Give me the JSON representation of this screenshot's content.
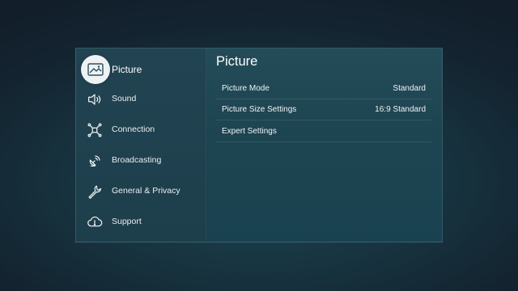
{
  "sidebar": {
    "items": [
      {
        "label": "Picture",
        "icon": "picture-icon",
        "selected": true
      },
      {
        "label": "Sound",
        "icon": "speaker-icon",
        "selected": false
      },
      {
        "label": "Connection",
        "icon": "connection-icon",
        "selected": false
      },
      {
        "label": "Broadcasting",
        "icon": "broadcast-icon",
        "selected": false
      },
      {
        "label": "General & Privacy",
        "icon": "wrench-icon",
        "selected": false
      },
      {
        "label": "Support",
        "icon": "support-cloud-icon",
        "selected": false
      }
    ]
  },
  "main": {
    "title": "Picture",
    "settings": [
      {
        "label": "Picture Mode",
        "value": "Standard"
      },
      {
        "label": "Picture Size Settings",
        "value": "16:9 Standard"
      },
      {
        "label": "Expert Settings",
        "value": ""
      }
    ]
  },
  "colors": {
    "background": "#13232f",
    "panel": "#1d4451",
    "sidebar": "#1d3e4b",
    "selected_icon_bg": "#eef2f3",
    "text": "#ffffff"
  }
}
